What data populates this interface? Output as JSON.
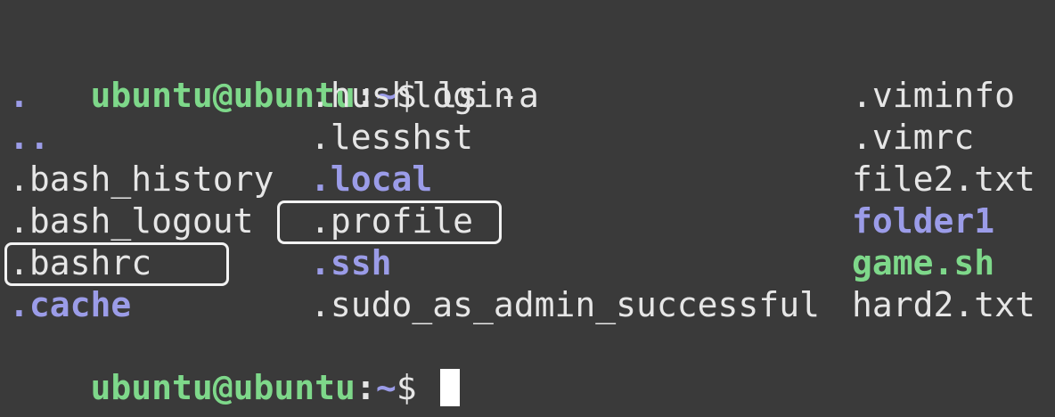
{
  "terminal": {
    "prompt_user": "ubuntu@ubuntu",
    "prompt_sep": ":",
    "prompt_path": "~",
    "prompt_dollar": "$ ",
    "command": "ls -a",
    "rows": [
      [
        {
          "name": ".",
          "type": "dir"
        },
        {
          "name": ".hushlogin",
          "type": "file"
        },
        {
          "name": ".viminfo",
          "type": "file"
        }
      ],
      [
        {
          "name": "..",
          "type": "dir"
        },
        {
          "name": ".lesshst",
          "type": "file"
        },
        {
          "name": ".vimrc",
          "type": "file"
        }
      ],
      [
        {
          "name": ".bash_history",
          "type": "file"
        },
        {
          "name": ".local",
          "type": "dir"
        },
        {
          "name": "file2.txt",
          "type": "file"
        }
      ],
      [
        {
          "name": ".bash_logout",
          "type": "file"
        },
        {
          "name": ".profile",
          "type": "file"
        },
        {
          "name": "folder1",
          "type": "dir"
        }
      ],
      [
        {
          "name": ".bashrc",
          "type": "file"
        },
        {
          "name": ".ssh",
          "type": "dir"
        },
        {
          "name": "game.sh",
          "type": "exec"
        }
      ],
      [
        {
          "name": ".cache",
          "type": "dir"
        },
        {
          "name": ".sudo_as_admin_successful",
          "type": "file"
        },
        {
          "name": "hard2.txt",
          "type": "file"
        }
      ]
    ],
    "highlighted": [
      ".bashrc",
      ".profile"
    ],
    "colors": {
      "background": "#3a3a3a",
      "prompt_user": "#7ed88a",
      "directory": "#9b9ce8",
      "executable": "#7ed88a",
      "text": "#e6e6e6",
      "highlight_border": "#f2f2f2"
    }
  }
}
